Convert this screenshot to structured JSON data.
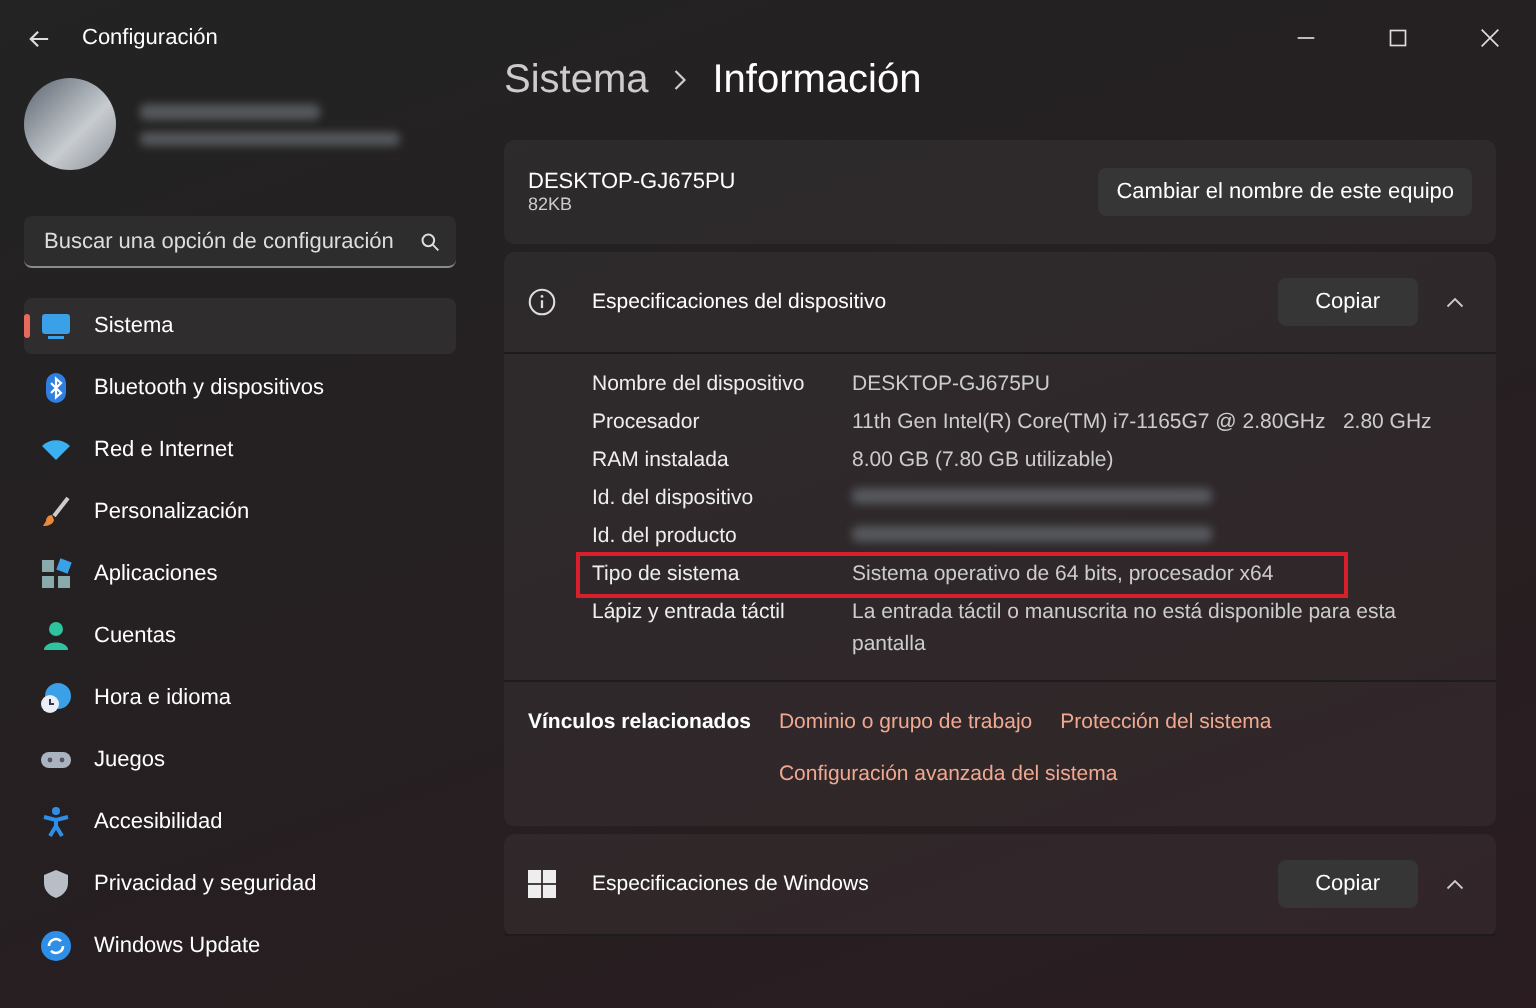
{
  "window": {
    "title": "Configuración"
  },
  "search": {
    "placeholder": "Buscar una opción de configuración"
  },
  "sidebar": {
    "items": [
      {
        "label": "Sistema",
        "kind": "monitor",
        "selected": true
      },
      {
        "label": "Bluetooth y dispositivos",
        "kind": "bluetooth",
        "selected": false
      },
      {
        "label": "Red e Internet",
        "kind": "wifi",
        "selected": false
      },
      {
        "label": "Personalización",
        "kind": "brush",
        "selected": false
      },
      {
        "label": "Aplicaciones",
        "kind": "apps",
        "selected": false
      },
      {
        "label": "Cuentas",
        "kind": "person",
        "selected": false
      },
      {
        "label": "Hora e idioma",
        "kind": "clock",
        "selected": false
      },
      {
        "label": "Juegos",
        "kind": "gamepad",
        "selected": false
      },
      {
        "label": "Accesibilidad",
        "kind": "accessibility",
        "selected": false
      },
      {
        "label": "Privacidad y seguridad",
        "kind": "shield",
        "selected": false
      },
      {
        "label": "Windows Update",
        "kind": "update",
        "selected": false
      }
    ]
  },
  "breadcrumb": [
    "Sistema",
    "Información"
  ],
  "device": {
    "name": "DESKTOP-GJ675PU",
    "subtitle": "82KB",
    "rename_button": "Cambiar el nombre de este equipo"
  },
  "sections": [
    {
      "title": "Especificaciones del dispositivo",
      "kind": "info",
      "copy_button": "Copiar",
      "expanded": true,
      "rows": [
        {
          "label": "Nombre del dispositivo",
          "value": "DESKTOP-GJ675PU",
          "redacted": false,
          "highlighted": false
        },
        {
          "label": "Procesador",
          "value": "11th Gen Intel(R) Core(TM) i7-1165G7 @ 2.80GHz   2.80 GHz",
          "redacted": false,
          "highlighted": false
        },
        {
          "label": "RAM instalada",
          "value": "8.00 GB (7.80 GB utilizable)",
          "redacted": false,
          "highlighted": false
        },
        {
          "label": "Id. del dispositivo",
          "redacted": true,
          "highlighted": false
        },
        {
          "label": "Id. del producto",
          "redacted": true,
          "highlighted": false
        },
        {
          "label": "Tipo de sistema",
          "value": "Sistema operativo de 64 bits, procesador x64",
          "redacted": false,
          "highlighted": true
        },
        {
          "label": "Lápiz y entrada táctil",
          "value": "La entrada táctil o manuscrita no está disponible para esta pantalla",
          "redacted": false,
          "highlighted": false
        }
      ],
      "related": {
        "label": "Vínculos relacionados",
        "links": [
          "Dominio o grupo de trabajo",
          "Protección del sistema",
          "Configuración avanzada del sistema"
        ]
      }
    },
    {
      "title": "Especificaciones de Windows",
      "kind": "windows",
      "copy_button": "Copiar",
      "expanded": true
    }
  ]
}
